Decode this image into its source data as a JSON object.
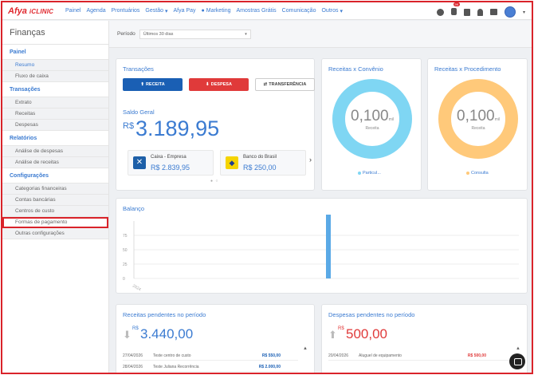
{
  "topbar": {
    "logo_a": "Afya",
    "logo_b": "iCLINIC",
    "nav": [
      {
        "label": "Painel"
      },
      {
        "label": "Agenda"
      },
      {
        "label": "Prontuários"
      },
      {
        "label": "Gestão",
        "caret": "▾"
      },
      {
        "label": "Afya Pay"
      },
      {
        "label": "Marketing",
        "icon": "●"
      },
      {
        "label": "Amostras Grátis"
      },
      {
        "label": "Comunicação"
      },
      {
        "label": "Outros",
        "caret": "▾"
      }
    ],
    "notif_badge": "99"
  },
  "sidebar": {
    "title": "Finanças",
    "sections": [
      {
        "title": "Painel",
        "items": [
          "Resumo",
          "Fluxo de caixa"
        ]
      },
      {
        "title": "Transações",
        "items": [
          "Extrato",
          "Receitas",
          "Despesas"
        ]
      },
      {
        "title": "Relatórios",
        "items": [
          "Análise de despesas",
          "Análise de receitas"
        ]
      },
      {
        "title": "Configurações",
        "items": [
          "Categorias financeiras",
          "Contas bancárias",
          "Centros de custo",
          "Formas de pagamento",
          "Outras configurações"
        ]
      }
    ]
  },
  "filter": {
    "label": "Período",
    "value": "Últimos 30 dias"
  },
  "transactions": {
    "title": "Transações",
    "btn_income": "RECEITA",
    "btn_expense": "DESPESA",
    "btn_transfer": "TRANSFERÊNCIA",
    "balance_label": "Saldo Geral",
    "currency": "R$",
    "balance": "3.189,95",
    "accounts": [
      {
        "name": "Caixa - Empresa",
        "value": "R$ 2.839,95"
      },
      {
        "name": "Banco do Brasil",
        "value": "R$ 250,00"
      }
    ]
  },
  "donut1": {
    "title": "Receitas x Convênio",
    "value": "0,100",
    "unit": "mil",
    "sub": "Receita",
    "legend": "Particul...",
    "color": "#7fd6f3"
  },
  "donut2": {
    "title": "Receitas x Procedimento",
    "value": "0,100",
    "unit": "mil",
    "sub": "Receita",
    "legend": "Consulta",
    "color": "#ffc97a"
  },
  "chart_data": {
    "type": "bar",
    "title": "Balanço",
    "categories": [
      "2024"
    ],
    "values": [
      100
    ],
    "yticks": [
      "75",
      "50",
      "25",
      "0"
    ],
    "ylim": [
      0,
      100
    ]
  },
  "pending_in": {
    "title": "Receitas pendentes no período",
    "currency": "R$",
    "value": "3.440,00",
    "rows": [
      {
        "date": "27/04/2026",
        "desc": "Teste centro de custo",
        "value": "R$ 550,00"
      },
      {
        "date": "28/04/2026",
        "desc": "Teste Juliana Recorrência",
        "value": "R$ 2.000,00"
      }
    ]
  },
  "pending_out": {
    "title": "Despesas pendentes no período",
    "currency": "R$",
    "value": "500,00",
    "rows": [
      {
        "date": "20/04/2026",
        "desc": "Aluguel de equipamento",
        "value": "R$ 500,00"
      }
    ]
  }
}
